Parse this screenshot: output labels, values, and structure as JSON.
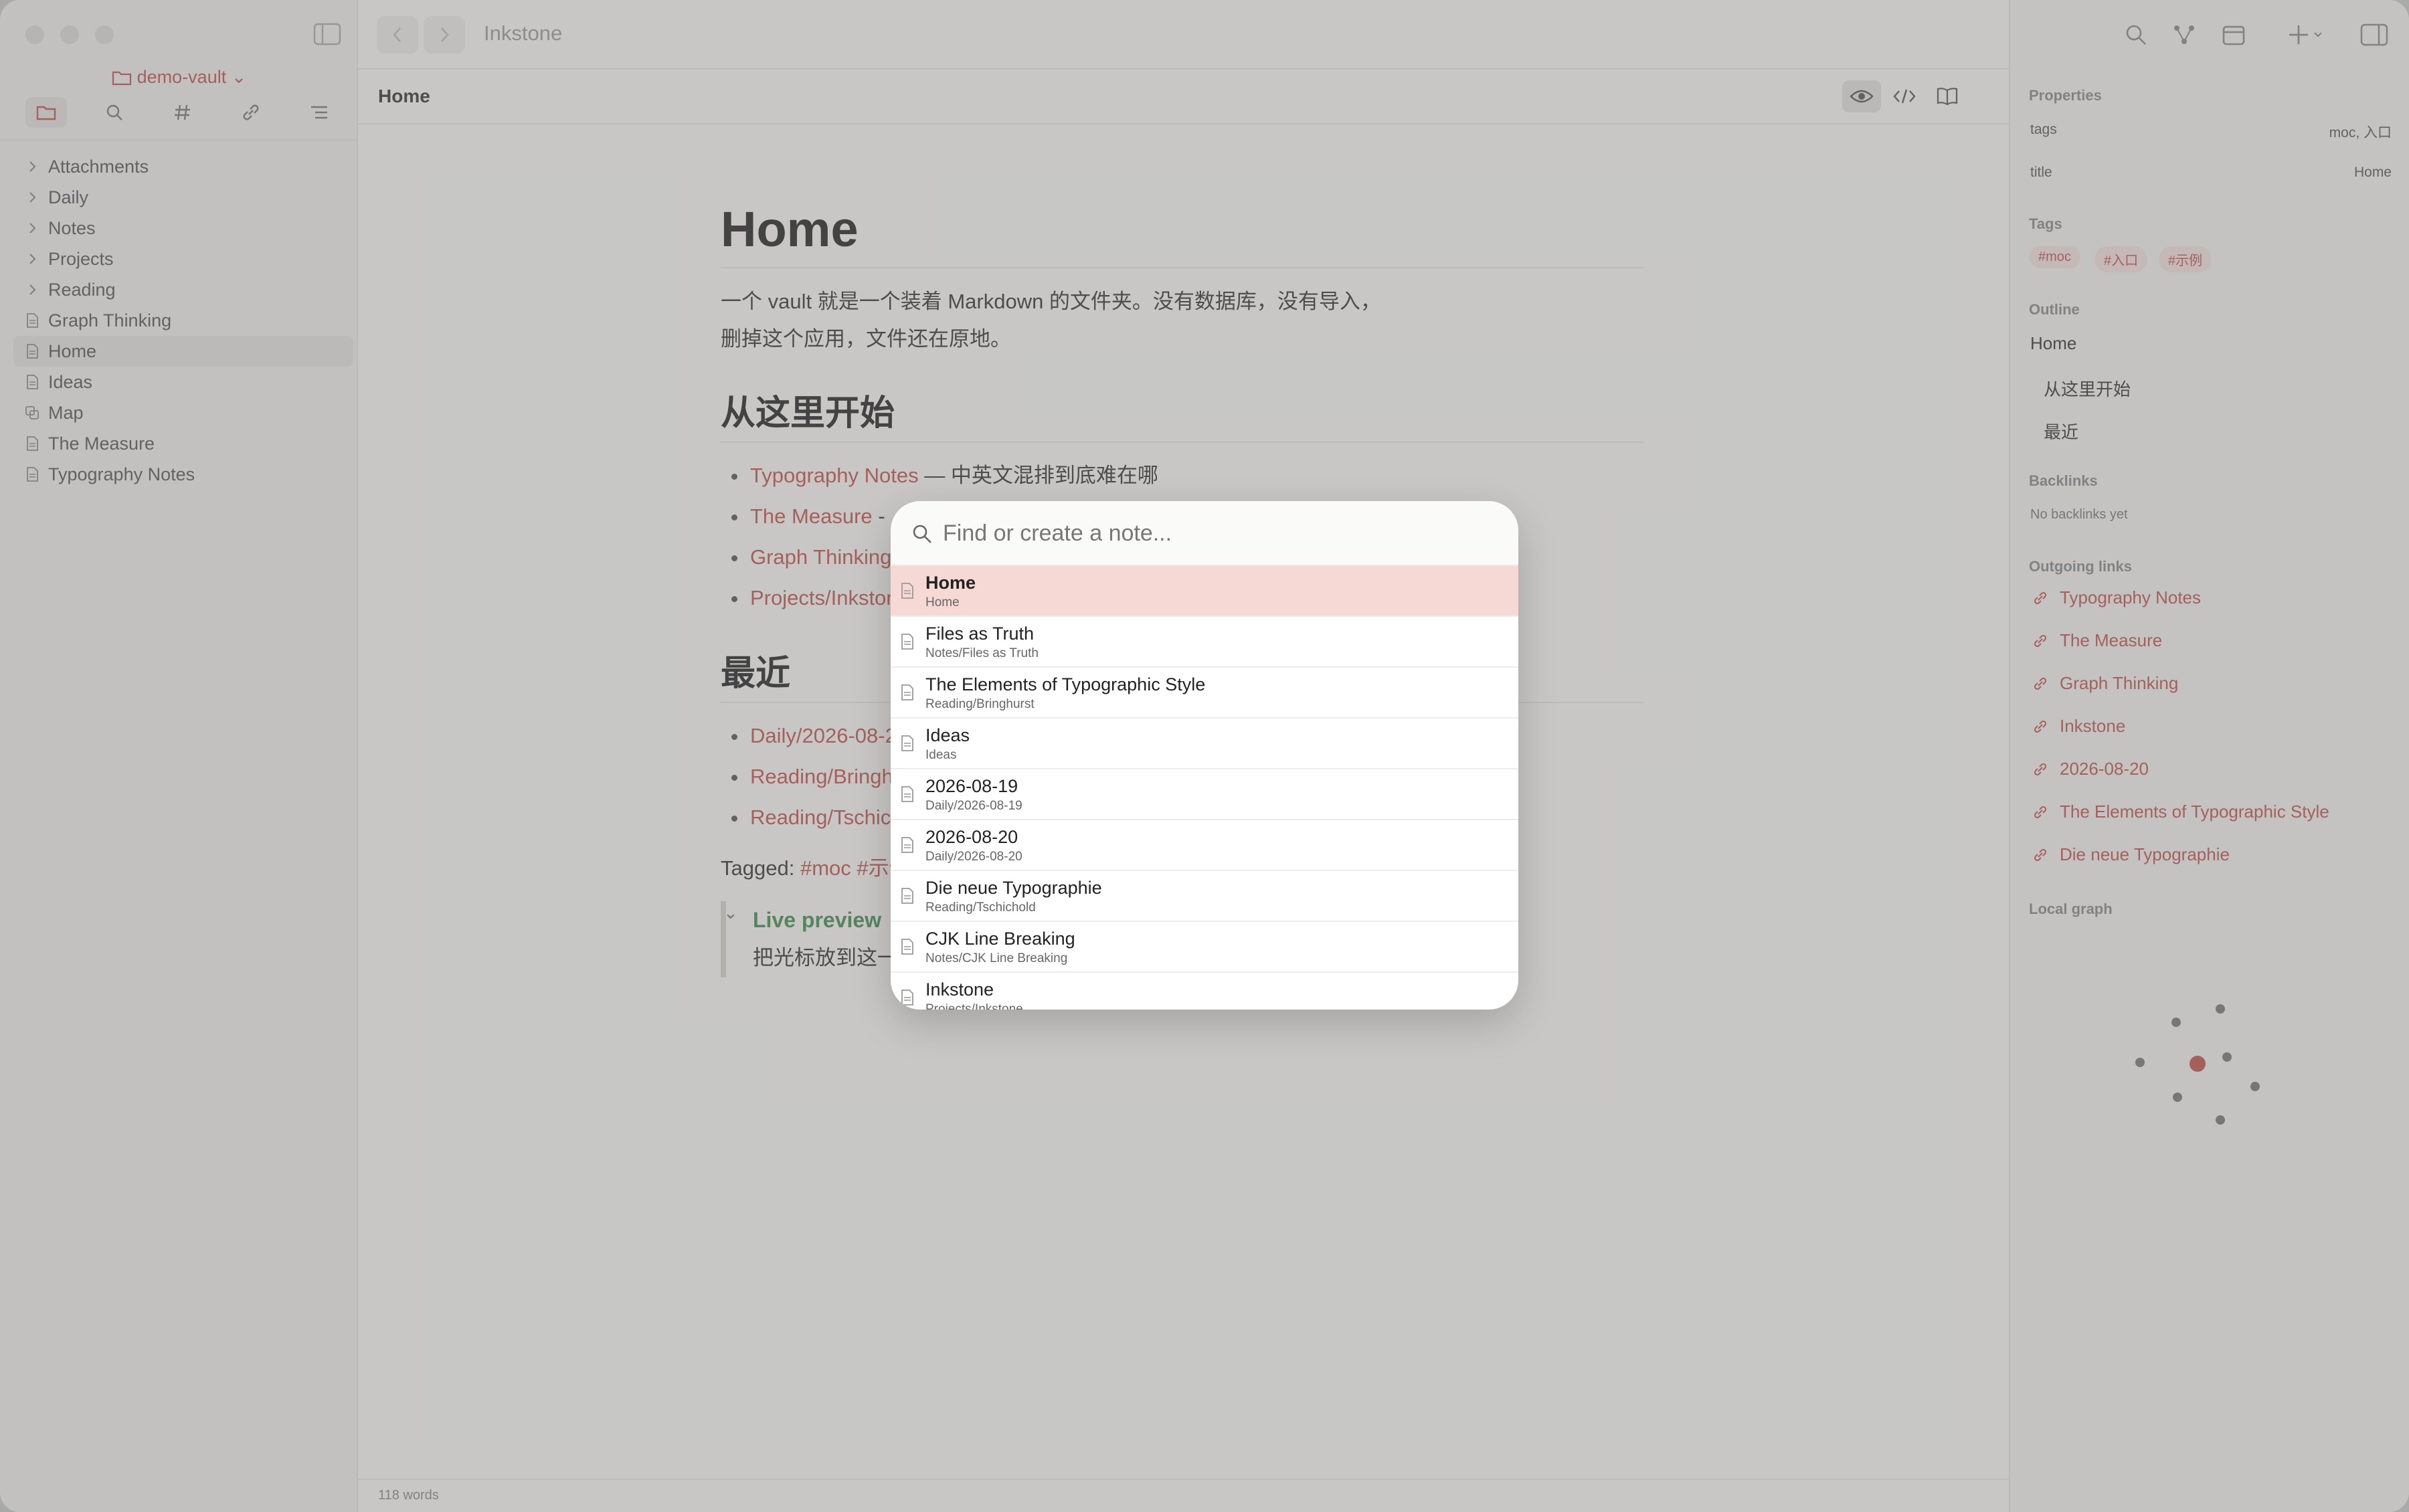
{
  "app": {
    "title": "Inkstone"
  },
  "sidebar": {
    "vault_name": "demo-vault",
    "tools": [
      "folder-icon",
      "search-icon",
      "hash-icon",
      "link-icon",
      "outline-icon"
    ],
    "items": [
      {
        "label": "Attachments",
        "type": "folder"
      },
      {
        "label": "Daily",
        "type": "folder"
      },
      {
        "label": "Notes",
        "type": "folder"
      },
      {
        "label": "Projects",
        "type": "folder"
      },
      {
        "label": "Reading",
        "type": "folder"
      },
      {
        "label": "Graph Thinking",
        "type": "file"
      },
      {
        "label": "Home",
        "type": "file",
        "selected": true
      },
      {
        "label": "Ideas",
        "type": "file"
      },
      {
        "label": "Map",
        "type": "canvas"
      },
      {
        "label": "The Measure",
        "type": "file"
      },
      {
        "label": "Typography Notes",
        "type": "file"
      }
    ]
  },
  "document": {
    "breadcrumb": "Home",
    "title": "Home",
    "intro_line1": "一个 vault 就是一个装着 Markdown 的文件夹。没有数据库，没有导入，",
    "intro_line2": "删掉这个应用，文件还在原地。",
    "section1": "从这里开始",
    "start_links": [
      {
        "link": "Typography Notes",
        "rest": " — 中英文混排到底难在哪"
      },
      {
        "link": "The Measure",
        "rest": " -"
      },
      {
        "link": "Graph Thinking",
        "rest": ""
      },
      {
        "link": "Projects/Inkstone",
        "rest": ""
      }
    ],
    "section2": "最近",
    "recent_links": [
      "Daily/2026-08-20",
      "Reading/Bringhurst",
      "Reading/Tschichold"
    ],
    "tagged_label": "Tagged:",
    "tagged_tags": "#moc #示例",
    "callout_title": "Live preview",
    "callout_body": "把光标放到这一行"
  },
  "status": {
    "words": "118 words"
  },
  "right_panel": {
    "properties_title": "Properties",
    "props": [
      {
        "key": "tags",
        "value": "moc, 入口"
      },
      {
        "key": "title",
        "value": "Home"
      }
    ],
    "tags_title": "Tags",
    "tags": [
      "#moc",
      "#入口",
      "#示例"
    ],
    "outline_title": "Outline",
    "outline": [
      "Home",
      "从这里开始",
      "最近"
    ],
    "backlinks_title": "Backlinks",
    "backlinks_empty": "No backlinks yet",
    "outgoing_title": "Outgoing links",
    "outgoing": [
      "Typography Notes",
      "The Measure",
      "Graph Thinking",
      "Inkstone",
      "2026-08-20",
      "The Elements of Typographic Style",
      "Die neue Typographie"
    ],
    "graph_title": "Local graph"
  },
  "palette": {
    "placeholder": "Find or create a note...",
    "results": [
      {
        "title": "Home",
        "path": "Home"
      },
      {
        "title": "Files as Truth",
        "path": "Notes/Files as Truth"
      },
      {
        "title": "The Elements of Typographic Style",
        "path": "Reading/Bringhurst"
      },
      {
        "title": "Ideas",
        "path": "Ideas"
      },
      {
        "title": "2026-08-19",
        "path": "Daily/2026-08-19"
      },
      {
        "title": "2026-08-20",
        "path": "Daily/2026-08-20"
      },
      {
        "title": "Die neue Typographie",
        "path": "Reading/Tschichold"
      },
      {
        "title": "CJK Line Breaking",
        "path": "Notes/CJK Line Breaking"
      },
      {
        "title": "Inkstone",
        "path": "Projects/Inkstone"
      }
    ]
  },
  "colors": {
    "accent": "#c0524a",
    "callout_green": "#3e8e4e",
    "palette_active": "#f6d9d5"
  }
}
